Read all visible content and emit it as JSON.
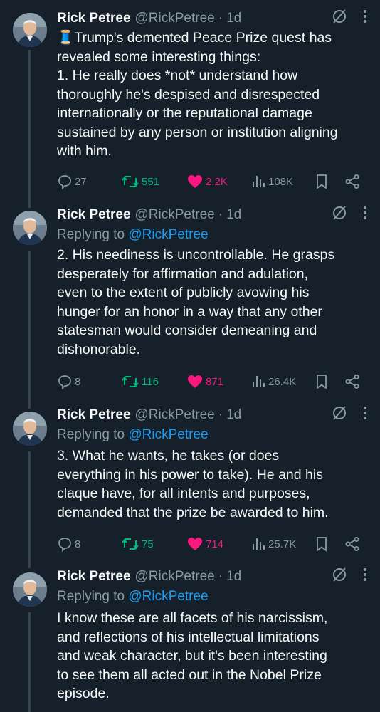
{
  "tweets": [
    {
      "display_name": "Rick Petree",
      "handle": "@RickPetree",
      "separator": "·",
      "time": "1d",
      "replying_prefix": "",
      "replying_handle": "",
      "text_lines": [
        "🧵Trump's demented Peace Prize quest has",
        "revealed some interesting things:",
        "1.  He really does *not* understand how",
        "thoroughly he's despised and disrespected",
        "internationally or the reputational damage",
        "sustained by any person or institution aligning",
        "with him."
      ],
      "replies": "27",
      "retweets": "551",
      "likes": "2.2K",
      "views": "108K"
    },
    {
      "display_name": "Rick Petree",
      "handle": "@RickPetree",
      "separator": "·",
      "time": "1d",
      "replying_prefix": "Replying to ",
      "replying_handle": "@RickPetree",
      "text_lines": [
        "2. His neediness is uncontrollable. He grasps",
        "desperately for affirmation and adulation,",
        "even to the extent of publicly avowing his",
        "hunger for an honor in a way that any other",
        "statesman would consider demeaning and",
        "dishonorable."
      ],
      "replies": "8",
      "retweets": "116",
      "likes": "871",
      "views": "26.4K"
    },
    {
      "display_name": "Rick Petree",
      "handle": "@RickPetree",
      "separator": "·",
      "time": "1d",
      "replying_prefix": "Replying to ",
      "replying_handle": "@RickPetree",
      "text_lines": [
        "3. What he wants, he takes (or does",
        "everything in his power to take). He and his",
        "claque have, for all intents and purposes,",
        "demanded that the prize be awarded to him."
      ],
      "replies": "8",
      "retweets": "75",
      "likes": "714",
      "views": "25.7K"
    },
    {
      "display_name": "Rick Petree",
      "handle": "@RickPetree",
      "separator": "·",
      "time": "1d",
      "replying_prefix": "Replying to ",
      "replying_handle": "@RickPetree",
      "text_lines": [
        "I know these are all facets of his narcissism,",
        "and reflections of his intellectual limitations",
        "and weak character, but it's been interesting",
        "to see them all acted out in the Nobel Prize",
        "episode."
      ]
    }
  ],
  "icons": {
    "reply": "speech-bubble-icon",
    "retweet": "retweet-arrows-icon",
    "like": "heart-icon",
    "views": "bar-chart-icon",
    "bookmark": "bookmark-icon",
    "share": "share-nodes-icon",
    "grok": "grok-slash-circle-icon",
    "more": "vertical-dots-icon"
  },
  "colors": {
    "background": "#15202b",
    "text": "#f7f9f9",
    "muted": "#8b98a5",
    "link": "#1d9bf0",
    "retweet": "#00ba7c",
    "like": "#f91880",
    "thread_line": "#38444d"
  }
}
